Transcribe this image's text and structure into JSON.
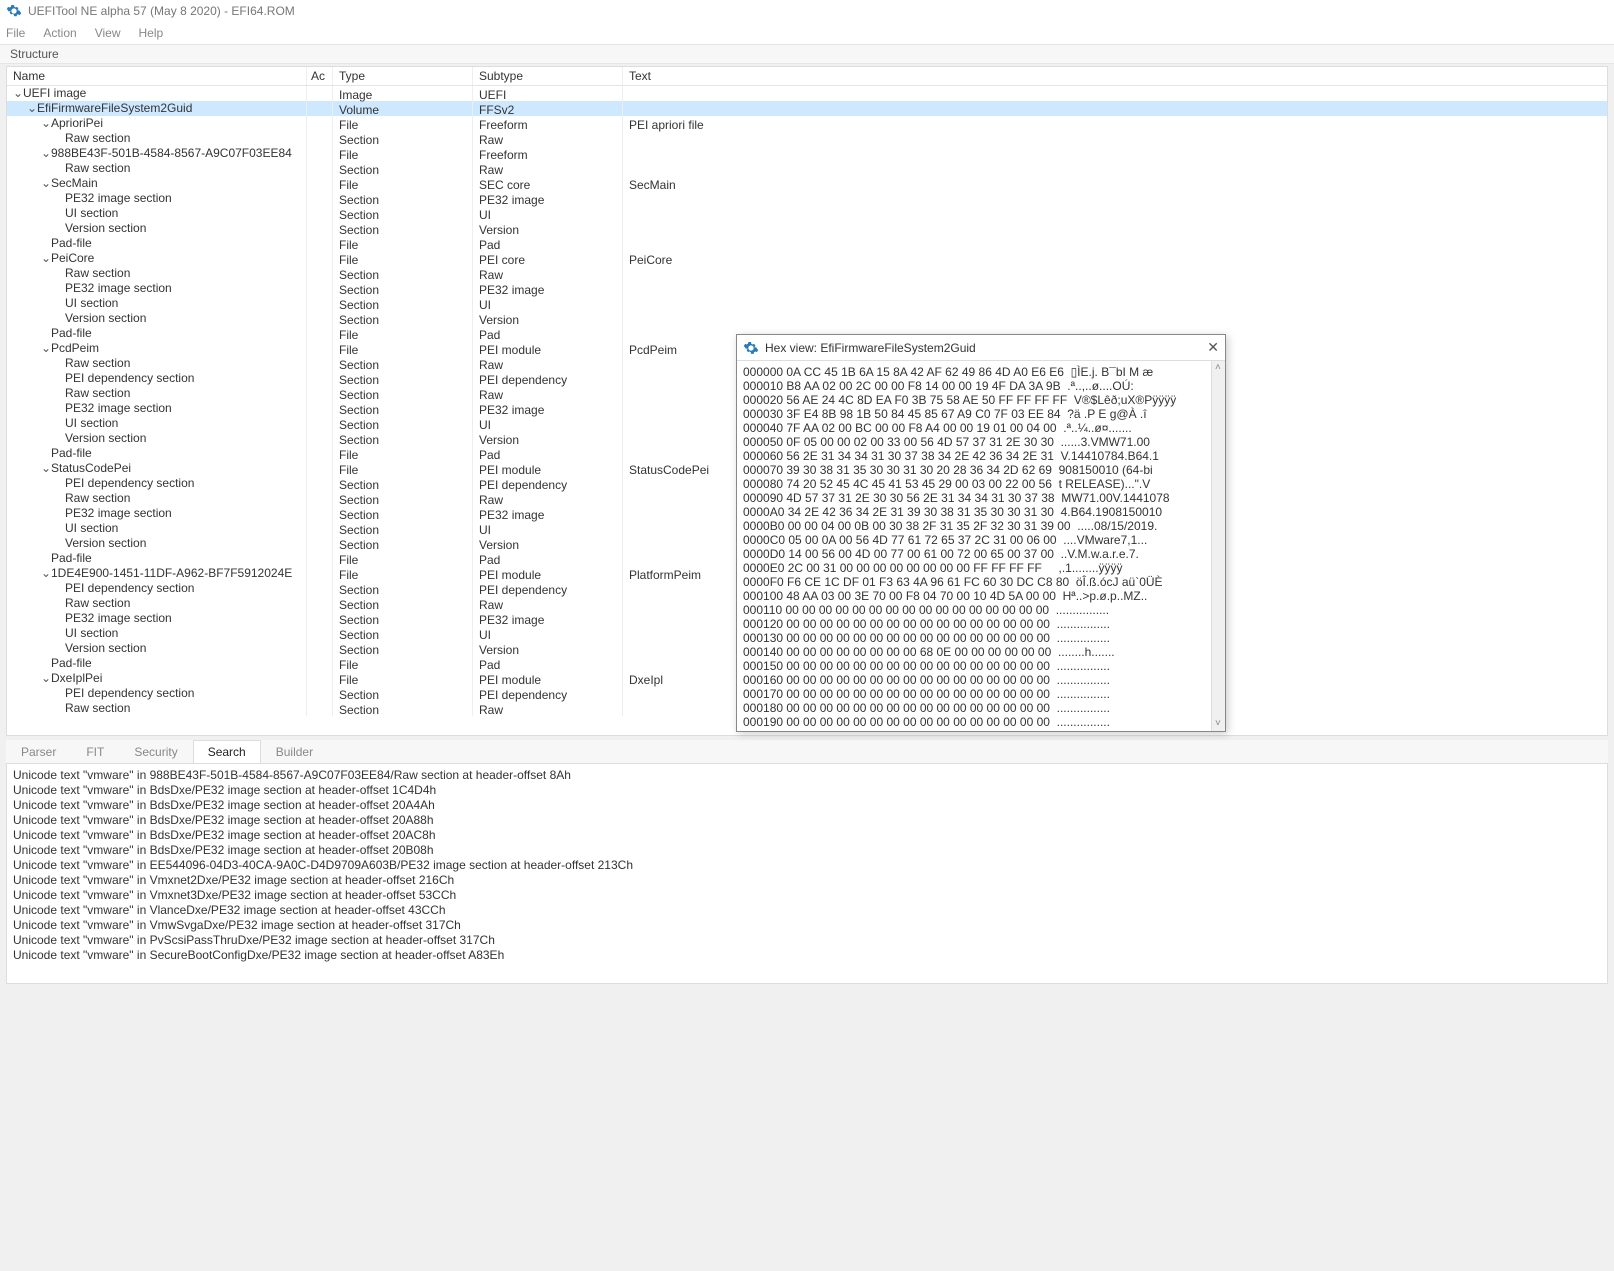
{
  "window": {
    "title": "UEFITool NE alpha 57 (May  8 2020) - EFI64.ROM"
  },
  "menubar": [
    "File",
    "Action",
    "View",
    "Help"
  ],
  "panels": {
    "structure": "Structure"
  },
  "columns": {
    "name": "Name",
    "ac": "Ac",
    "type": "Type",
    "subtype": "Subtype",
    "text": "Text"
  },
  "tree": [
    {
      "d": 0,
      "exp": true,
      "name": "UEFI image",
      "type": "Image",
      "sub": "UEFI",
      "text": ""
    },
    {
      "d": 1,
      "exp": true,
      "name": "EfiFirmwareFileSystem2Guid",
      "type": "Volume",
      "sub": "FFSv2",
      "text": "",
      "sel": true
    },
    {
      "d": 2,
      "exp": true,
      "name": "AprioriPei",
      "type": "File",
      "sub": "Freeform",
      "text": "PEI apriori file"
    },
    {
      "d": 3,
      "exp": null,
      "name": "Raw section",
      "type": "Section",
      "sub": "Raw",
      "text": ""
    },
    {
      "d": 2,
      "exp": true,
      "name": "988BE43F-501B-4584-8567-A9C07F03EE84",
      "type": "File",
      "sub": "Freeform",
      "text": ""
    },
    {
      "d": 3,
      "exp": null,
      "name": "Raw section",
      "type": "Section",
      "sub": "Raw",
      "text": ""
    },
    {
      "d": 2,
      "exp": true,
      "name": "SecMain",
      "type": "File",
      "sub": "SEC core",
      "text": "SecMain"
    },
    {
      "d": 3,
      "exp": null,
      "name": "PE32 image section",
      "type": "Section",
      "sub": "PE32 image",
      "text": ""
    },
    {
      "d": 3,
      "exp": null,
      "name": "UI section",
      "type": "Section",
      "sub": "UI",
      "text": ""
    },
    {
      "d": 3,
      "exp": null,
      "name": "Version section",
      "type": "Section",
      "sub": "Version",
      "text": ""
    },
    {
      "d": 2,
      "exp": null,
      "name": "Pad-file",
      "type": "File",
      "sub": "Pad",
      "text": ""
    },
    {
      "d": 2,
      "exp": true,
      "name": "PeiCore",
      "type": "File",
      "sub": "PEI core",
      "text": "PeiCore"
    },
    {
      "d": 3,
      "exp": null,
      "name": "Raw section",
      "type": "Section",
      "sub": "Raw",
      "text": ""
    },
    {
      "d": 3,
      "exp": null,
      "name": "PE32 image section",
      "type": "Section",
      "sub": "PE32 image",
      "text": ""
    },
    {
      "d": 3,
      "exp": null,
      "name": "UI section",
      "type": "Section",
      "sub": "UI",
      "text": ""
    },
    {
      "d": 3,
      "exp": null,
      "name": "Version section",
      "type": "Section",
      "sub": "Version",
      "text": ""
    },
    {
      "d": 2,
      "exp": null,
      "name": "Pad-file",
      "type": "File",
      "sub": "Pad",
      "text": ""
    },
    {
      "d": 2,
      "exp": true,
      "name": "PcdPeim",
      "type": "File",
      "sub": "PEI module",
      "text": "PcdPeim"
    },
    {
      "d": 3,
      "exp": null,
      "name": "Raw section",
      "type": "Section",
      "sub": "Raw",
      "text": ""
    },
    {
      "d": 3,
      "exp": null,
      "name": "PEI dependency section",
      "type": "Section",
      "sub": "PEI dependency",
      "text": ""
    },
    {
      "d": 3,
      "exp": null,
      "name": "Raw section",
      "type": "Section",
      "sub": "Raw",
      "text": ""
    },
    {
      "d": 3,
      "exp": null,
      "name": "PE32 image section",
      "type": "Section",
      "sub": "PE32 image",
      "text": ""
    },
    {
      "d": 3,
      "exp": null,
      "name": "UI section",
      "type": "Section",
      "sub": "UI",
      "text": ""
    },
    {
      "d": 3,
      "exp": null,
      "name": "Version section",
      "type": "Section",
      "sub": "Version",
      "text": ""
    },
    {
      "d": 2,
      "exp": null,
      "name": "Pad-file",
      "type": "File",
      "sub": "Pad",
      "text": ""
    },
    {
      "d": 2,
      "exp": true,
      "name": "StatusCodePei",
      "type": "File",
      "sub": "PEI module",
      "text": "StatusCodePei"
    },
    {
      "d": 3,
      "exp": null,
      "name": "PEI dependency section",
      "type": "Section",
      "sub": "PEI dependency",
      "text": ""
    },
    {
      "d": 3,
      "exp": null,
      "name": "Raw section",
      "type": "Section",
      "sub": "Raw",
      "text": ""
    },
    {
      "d": 3,
      "exp": null,
      "name": "PE32 image section",
      "type": "Section",
      "sub": "PE32 image",
      "text": ""
    },
    {
      "d": 3,
      "exp": null,
      "name": "UI section",
      "type": "Section",
      "sub": "UI",
      "text": ""
    },
    {
      "d": 3,
      "exp": null,
      "name": "Version section",
      "type": "Section",
      "sub": "Version",
      "text": ""
    },
    {
      "d": 2,
      "exp": null,
      "name": "Pad-file",
      "type": "File",
      "sub": "Pad",
      "text": ""
    },
    {
      "d": 2,
      "exp": true,
      "name": "1DE4E900-1451-11DF-A962-BF7F5912024E",
      "type": "File",
      "sub": "PEI module",
      "text": "PlatformPeim"
    },
    {
      "d": 3,
      "exp": null,
      "name": "PEI dependency section",
      "type": "Section",
      "sub": "PEI dependency",
      "text": ""
    },
    {
      "d": 3,
      "exp": null,
      "name": "Raw section",
      "type": "Section",
      "sub": "Raw",
      "text": ""
    },
    {
      "d": 3,
      "exp": null,
      "name": "PE32 image section",
      "type": "Section",
      "sub": "PE32 image",
      "text": ""
    },
    {
      "d": 3,
      "exp": null,
      "name": "UI section",
      "type": "Section",
      "sub": "UI",
      "text": ""
    },
    {
      "d": 3,
      "exp": null,
      "name": "Version section",
      "type": "Section",
      "sub": "Version",
      "text": ""
    },
    {
      "d": 2,
      "exp": null,
      "name": "Pad-file",
      "type": "File",
      "sub": "Pad",
      "text": ""
    },
    {
      "d": 2,
      "exp": true,
      "name": "DxeIplPei",
      "type": "File",
      "sub": "PEI module",
      "text": "DxeIpl"
    },
    {
      "d": 3,
      "exp": null,
      "name": "PEI dependency section",
      "type": "Section",
      "sub": "PEI dependency",
      "text": ""
    },
    {
      "d": 3,
      "exp": null,
      "name": "Raw section",
      "type": "Section",
      "sub": "Raw",
      "text": ""
    }
  ],
  "tabs": [
    "Parser",
    "FIT",
    "Security",
    "Search",
    "Builder"
  ],
  "active_tab": 3,
  "results": [
    "Unicode text \"vmware\" in 988BE43F-501B-4584-8567-A9C07F03EE84/Raw section at header-offset 8Ah",
    "Unicode text \"vmware\" in BdsDxe/PE32 image section at header-offset 1C4D4h",
    "Unicode text \"vmware\" in BdsDxe/PE32 image section at header-offset 20A4Ah",
    "Unicode text \"vmware\" in BdsDxe/PE32 image section at header-offset 20A88h",
    "Unicode text \"vmware\" in BdsDxe/PE32 image section at header-offset 20AC8h",
    "Unicode text \"vmware\" in BdsDxe/PE32 image section at header-offset 20B08h",
    "Unicode text \"vmware\" in EE544096-04D3-40CA-9A0C-D4D9709A603B/PE32 image section at header-offset 213Ch",
    "Unicode text \"vmware\" in Vmxnet2Dxe/PE32 image section at header-offset 216Ch",
    "Unicode text \"vmware\" in Vmxnet3Dxe/PE32 image section at header-offset 53CCh",
    "Unicode text \"vmware\" in VlanceDxe/PE32 image section at header-offset 43CCh",
    "Unicode text \"vmware\" in VmwSvgaDxe/PE32 image section at header-offset 317Ch",
    "Unicode text \"vmware\" in PvScsiPassThruDxe/PE32 image section at header-offset 317Ch",
    "Unicode text \"vmware\" in SecureBootConfigDxe/PE32 image section at header-offset A83Eh"
  ],
  "hex": {
    "title": "Hex view: EfiFirmwareFileSystem2Guid",
    "lines": [
      "000000 0A CC 45 1B 6A 15 8A 42 AF 62 49 86 4D A0 E6 E6  ▯ÌE.j. B¯bI M æ",
      "000010 B8 AA 02 00 2C 00 00 F8 14 00 00 19 4F DA 3A 9B  .ª..,..ø....OÚ:",
      "000020 56 AE 24 4C 8D EA F0 3B 75 58 AE 50 FF FF FF FF  V®$Lêð;uX®Pÿÿÿÿ",
      "000030 3F E4 8B 98 1B 50 84 45 85 67 A9 C0 7F 03 EE 84  ?ä .P E g@À .î",
      "000040 7F AA 02 00 BC 00 00 F8 A4 00 00 19 01 00 04 00  .ª..¼..ø¤.......",
      "000050 0F 05 00 00 02 00 33 00 56 4D 57 37 31 2E 30 30  ......3.VMW71.00",
      "000060 56 2E 31 34 34 31 30 37 38 34 2E 42 36 34 2E 31  V.14410784.B64.1",
      "000070 39 30 38 31 35 30 30 31 30 20 28 36 34 2D 62 69  908150010 (64-bi",
      "000080 74 20 52 45 4C 45 41 53 45 29 00 03 00 22 00 56  t RELEASE)...\".V",
      "000090 4D 57 37 31 2E 30 30 56 2E 31 34 34 31 30 37 38  MW71.00V.1441078",
      "0000A0 34 2E 42 36 34 2E 31 39 30 38 31 35 30 30 31 30  4.B64.1908150010",
      "0000B0 00 00 04 00 0B 00 30 38 2F 31 35 2F 32 30 31 39 00  .....08/15/2019.",
      "0000C0 05 00 0A 00 56 4D 77 61 72 65 37 2C 31 00 06 00  ....VMware7,1...",
      "0000D0 14 00 56 00 4D 00 77 00 61 00 72 00 65 00 37 00  ..V.M.w.a.r.e.7.",
      "0000E0 2C 00 31 00 00 00 00 00 00 00 00 FF FF FF FF     ,.1........ÿÿÿÿ",
      "0000F0 F6 CE 1C DF 01 F3 63 4A 96 61 FC 60 30 DC C8 80  öÎ.ß.ócJ aü`0ÜÈ",
      "000100 48 AA 03 00 3E 70 00 F8 04 70 00 10 4D 5A 00 00  Hª..>p.ø.p..MZ..",
      "000110 00 00 00 00 00 00 00 00 00 00 00 00 00 00 00 00  ................",
      "000120 00 00 00 00 00 00 00 00 00 00 00 00 00 00 00 00  ................",
      "000130 00 00 00 00 00 00 00 00 00 00 00 00 00 00 00 00  ................",
      "000140 00 00 00 00 00 00 00 00 68 0E 00 00 00 00 00 00  ........h.......",
      "000150 00 00 00 00 00 00 00 00 00 00 00 00 00 00 00 00  ................",
      "000160 00 00 00 00 00 00 00 00 00 00 00 00 00 00 00 00  ................",
      "000170 00 00 00 00 00 00 00 00 00 00 00 00 00 00 00 00  ................",
      "000180 00 00 00 00 00 00 00 00 00 00 00 00 00 00 00 00  ................",
      "000190 00 00 00 00 00 00 00 00 00 00 00 00 00 00 00 00  ................"
    ]
  }
}
